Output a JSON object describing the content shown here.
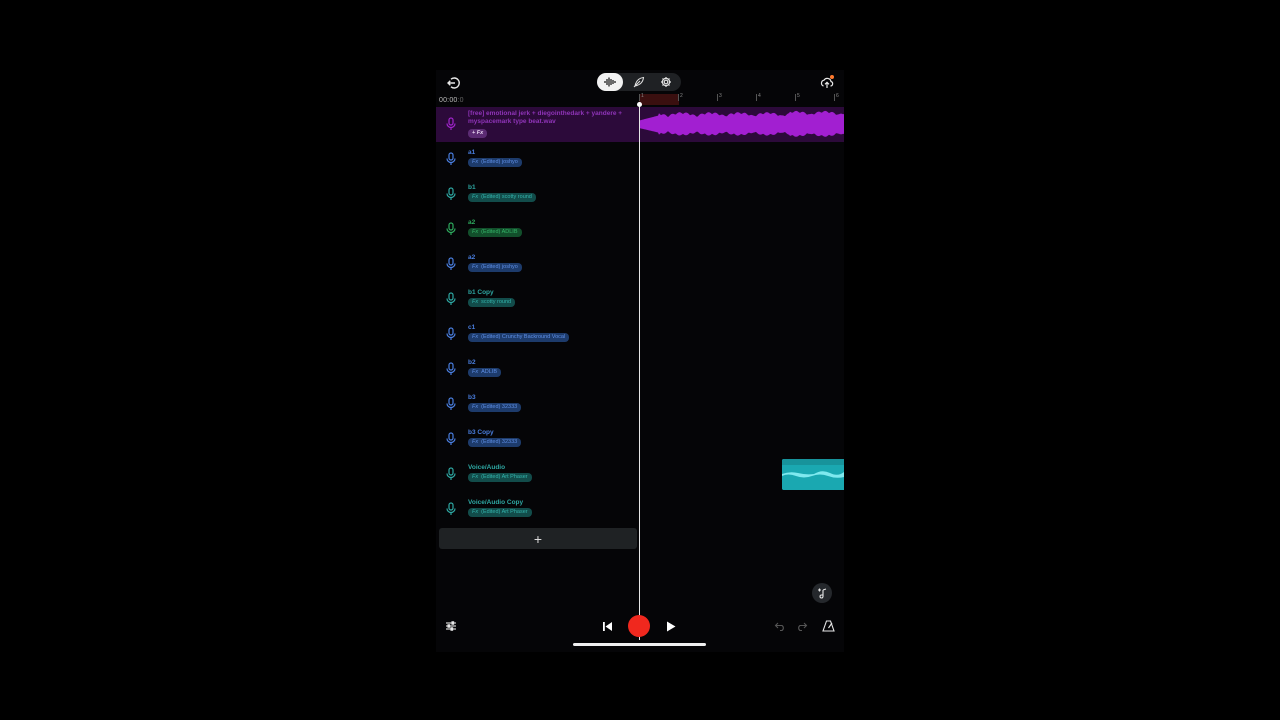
{
  "app": {
    "name": "Music recording app"
  },
  "header": {
    "time": "00:00",
    "time_ms": ":0",
    "ruler_ticks": [
      "1",
      "2",
      "3",
      "4",
      "5",
      "6"
    ],
    "view_tabs": [
      {
        "icon": "waveform-icon",
        "active": true
      },
      {
        "icon": "feather-icon",
        "active": false
      },
      {
        "icon": "gear-icon",
        "active": false
      }
    ]
  },
  "beat_track": {
    "name": "[free] emotional jerk + diegointhedark + yandere + myspacemark type beat.wav",
    "fx_label": "+ Fx",
    "color": "#a21fd1"
  },
  "tracks": [
    {
      "name": "a1",
      "fx_prefix": "Fx",
      "fx": "(Edited) joshyo",
      "color": "#4a7fe0",
      "tag_bg": "#1d3b6b",
      "tag_fg": "#5e8fe6"
    },
    {
      "name": "b1",
      "fx_prefix": "Fx",
      "fx": "(Edited) scotty round",
      "color": "#2ea8a3",
      "tag_bg": "#124c4a",
      "tag_fg": "#33b5ad"
    },
    {
      "name": "a2",
      "fx_prefix": "Fx",
      "fx": "(Edited) ADLIB",
      "color": "#2eaa5e",
      "tag_bg": "#124f2b",
      "tag_fg": "#35b66a"
    },
    {
      "name": "a2",
      "fx_prefix": "Fx",
      "fx": "(Edited) joshyo",
      "color": "#4a7fe0",
      "tag_bg": "#1d3b6b",
      "tag_fg": "#5e8fe6"
    },
    {
      "name": "b1 Copy",
      "fx_prefix": "Fx",
      "fx": "scotty round",
      "color": "#2ea8a3",
      "tag_bg": "#124c4a",
      "tag_fg": "#33b5ad"
    },
    {
      "name": "c1",
      "fx_prefix": "Fx",
      "fx": "(Edited) Crunchy Backround Vocal",
      "color": "#4a7fe0",
      "tag_bg": "#1d3b6b",
      "tag_fg": "#5e8fe6"
    },
    {
      "name": "b2",
      "fx_prefix": "Fx",
      "fx": "ADLIB",
      "color": "#4a7fe0",
      "tag_bg": "#1d3b6b",
      "tag_fg": "#5e8fe6"
    },
    {
      "name": "b3",
      "fx_prefix": "Fx",
      "fx": "(Edited) 32333",
      "color": "#4a7fe0",
      "tag_bg": "#1d3b6b",
      "tag_fg": "#5e8fe6"
    },
    {
      "name": "b3 Copy",
      "fx_prefix": "Fx",
      "fx": "(Edited) 32333",
      "color": "#4a7fe0",
      "tag_bg": "#1d3b6b",
      "tag_fg": "#5e8fe6"
    },
    {
      "name": "Voice/Audio",
      "fx_prefix": "Fx",
      "fx": "(Edited) Art Phaser",
      "color": "#2ea8a3",
      "tag_bg": "#124c4a",
      "tag_fg": "#33b5ad"
    },
    {
      "name": "Voice/Audio Copy",
      "fx_prefix": "Fx",
      "fx": "(Edited) Art Phaser",
      "color": "#2ea8a3",
      "tag_bg": "#124c4a",
      "tag_fg": "#33b5ad"
    }
  ],
  "add_track_label": "+",
  "transport": {
    "record_color": "#f0281e"
  }
}
